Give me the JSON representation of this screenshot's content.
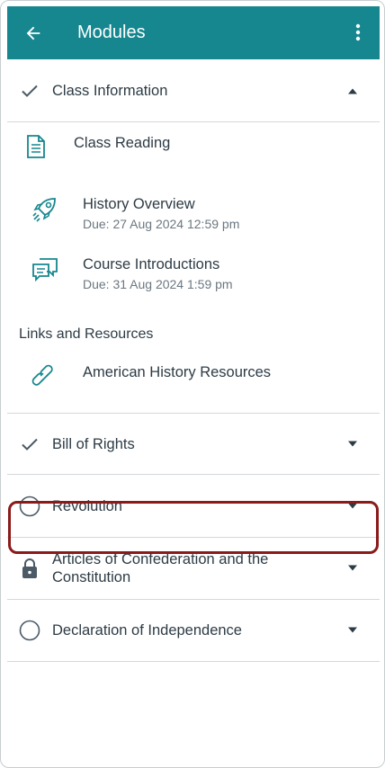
{
  "header": {
    "title": "Modules",
    "back_icon": "arrow-left-icon",
    "menu_icon": "more-vertical-icon",
    "bg_color": "#16878f"
  },
  "modules": [
    {
      "label": "Class Information",
      "status": "complete",
      "expanded": true,
      "items": [
        {
          "name": "Class Reading",
          "icon": "document-icon"
        },
        {
          "name": "History Overview",
          "due": "Due: 27 Aug 2024 12:59 pm",
          "icon": "rocket-icon"
        },
        {
          "name": "Course Introductions",
          "due": "Due: 31 Aug 2024 1:59 pm",
          "icon": "discussion-icon"
        }
      ],
      "subheader": "Links and Resources",
      "sub_items": [
        {
          "name": "American History Resources",
          "icon": "link-icon"
        }
      ]
    },
    {
      "label": "Bill of Rights",
      "status": "complete",
      "expanded": false
    },
    {
      "label": "Revolution",
      "status": "not-started",
      "expanded": false,
      "highlighted": true
    },
    {
      "label": "Articles of Confederation and the Constitution",
      "status": "locked",
      "expanded": false
    },
    {
      "label": "Declaration of Independence",
      "status": "not-started",
      "expanded": false
    }
  ],
  "colors": {
    "accent": "#16878f",
    "highlight": "#8b1a1a",
    "icon": "#16878f",
    "text": "#2d3b45",
    "secondary_text": "#6b7780"
  }
}
